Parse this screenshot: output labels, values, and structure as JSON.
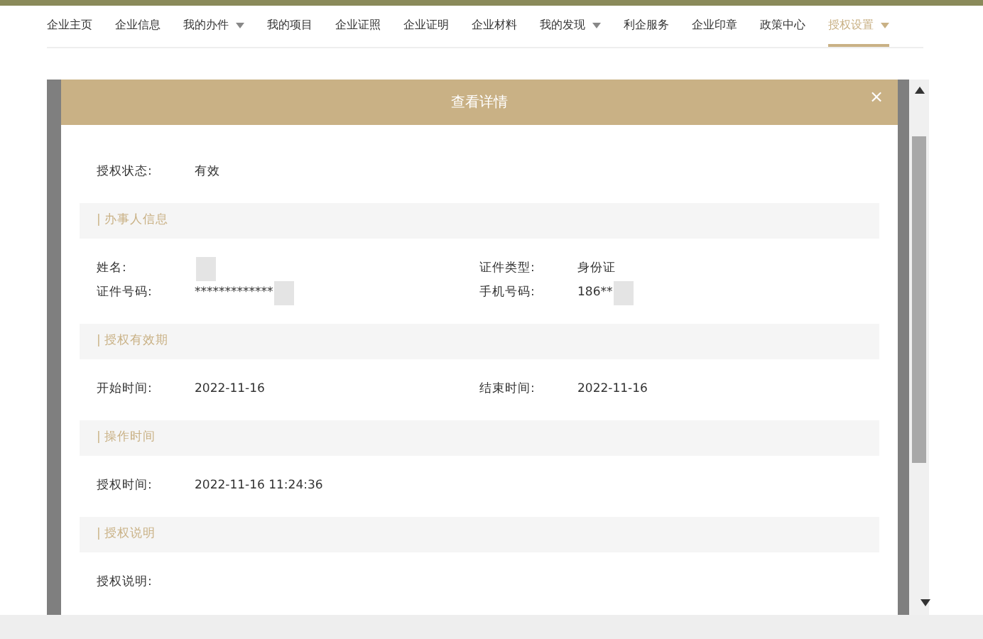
{
  "nav": [
    {
      "label": "企业主页",
      "dropdown": false,
      "selected": false
    },
    {
      "label": "企业信息",
      "dropdown": false,
      "selected": false
    },
    {
      "label": "我的办件",
      "dropdown": true,
      "selected": false
    },
    {
      "label": "我的项目",
      "dropdown": false,
      "selected": false
    },
    {
      "label": "企业证照",
      "dropdown": false,
      "selected": false
    },
    {
      "label": "企业证明",
      "dropdown": false,
      "selected": false
    },
    {
      "label": "企业材料",
      "dropdown": false,
      "selected": false
    },
    {
      "label": "我的发现",
      "dropdown": true,
      "selected": false
    },
    {
      "label": "利企服务",
      "dropdown": false,
      "selected": false
    },
    {
      "label": "企业印章",
      "dropdown": false,
      "selected": false
    },
    {
      "label": "政策中心",
      "dropdown": false,
      "selected": false
    },
    {
      "label": "授权设置",
      "dropdown": true,
      "selected": true
    }
  ],
  "dialog": {
    "title": "查看详情",
    "close": "×",
    "blocks": [
      {
        "kind": "rows",
        "rows": [
          [
            {
              "label": "授权状态:",
              "value": "有效",
              "redacted": false
            }
          ]
        ]
      },
      {
        "kind": "section",
        "title": "| 办事人信息"
      },
      {
        "kind": "rows",
        "rows": [
          [
            {
              "label": "姓名:",
              "redacted": true
            },
            {
              "label": "证件类型:",
              "value": "身份证",
              "redacted": false
            }
          ],
          [
            {
              "label": "证件号码:",
              "value": "*************",
              "redacted": true
            },
            {
              "label": "手机号码:",
              "value": "186**",
              "redacted": true
            }
          ]
        ]
      },
      {
        "kind": "section",
        "title": "| 授权有效期"
      },
      {
        "kind": "rows",
        "rows": [
          [
            {
              "label": "开始时间:",
              "value": "2022-11-16",
              "redacted": false
            },
            {
              "label": "结束时间:",
              "value": "2022-11-16",
              "redacted": false
            }
          ]
        ]
      },
      {
        "kind": "section",
        "title": "| 操作时间"
      },
      {
        "kind": "rows",
        "rows": [
          [
            {
              "label": "授权时间:",
              "value": "2022-11-16 11:24:36",
              "redacted": false
            }
          ]
        ]
      },
      {
        "kind": "section",
        "title": "| 授权说明"
      },
      {
        "kind": "rows",
        "rows": [
          [
            {
              "label": "授权说明:",
              "redacted": false
            }
          ]
        ]
      }
    ]
  }
}
